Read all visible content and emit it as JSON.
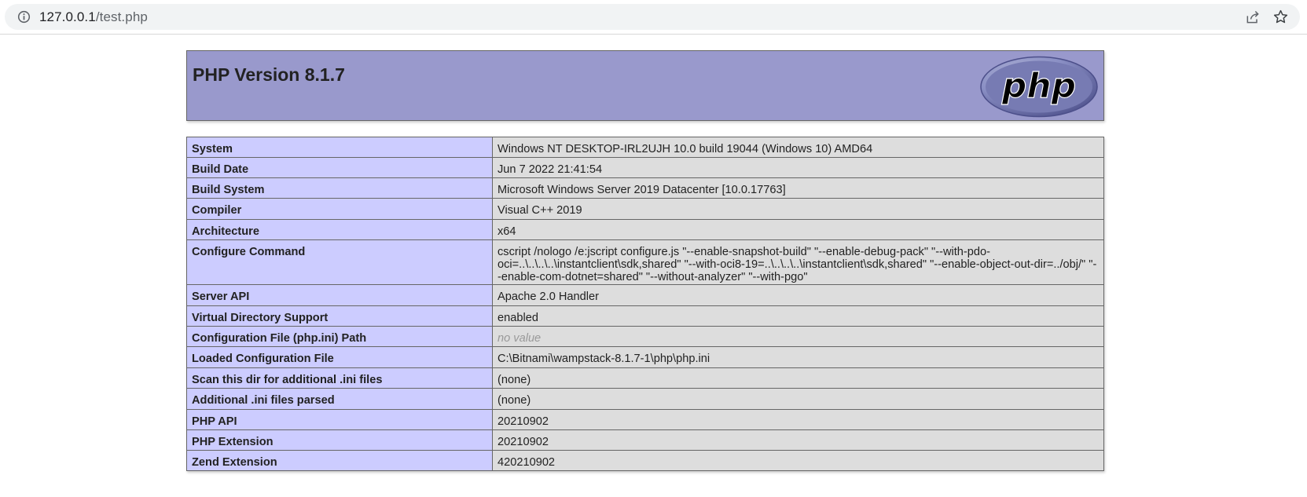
{
  "browser": {
    "url_host": "127.0.0.1",
    "url_path": "/test.php",
    "icons": {
      "site_info": "info-icon",
      "share": "share-icon",
      "bookmark": "star-icon"
    }
  },
  "header": {
    "title": "PHP Version 8.1.7",
    "logo_text": "php",
    "colors": {
      "header_bg": "#9999cc",
      "label_bg": "#ccccff",
      "value_bg": "#dddddd"
    }
  },
  "rows": [
    {
      "label": "System",
      "value": "Windows NT DESKTOP-IRL2UJH 10.0 build 19044 (Windows 10) AMD64"
    },
    {
      "label": "Build Date",
      "value": "Jun 7 2022 21:41:54"
    },
    {
      "label": "Build System",
      "value": "Microsoft Windows Server 2019 Datacenter [10.0.17763]"
    },
    {
      "label": "Compiler",
      "value": "Visual C++ 2019"
    },
    {
      "label": "Architecture",
      "value": "x64"
    },
    {
      "label": "Configure Command",
      "value": "cscript /nologo /e:jscript configure.js \"--enable-snapshot-build\" \"--enable-debug-pack\" \"--with-pdo-oci=..\\..\\..\\..\\instantclient\\sdk,shared\" \"--with-oci8-19=..\\..\\..\\..\\instantclient\\sdk,shared\" \"--enable-object-out-dir=../obj/\" \"--enable-com-dotnet=shared\" \"--without-analyzer\" \"--with-pgo\""
    },
    {
      "label": "Server API",
      "value": "Apache 2.0 Handler"
    },
    {
      "label": "Virtual Directory Support",
      "value": "enabled"
    },
    {
      "label": "Configuration File (php.ini) Path",
      "value": "no value",
      "novalue": true
    },
    {
      "label": "Loaded Configuration File",
      "value": "C:\\Bitnami\\wampstack-8.1.7-1\\php\\php.ini"
    },
    {
      "label": "Scan this dir for additional .ini files",
      "value": "(none)"
    },
    {
      "label": "Additional .ini files parsed",
      "value": "(none)"
    },
    {
      "label": "PHP API",
      "value": "20210902"
    },
    {
      "label": "PHP Extension",
      "value": "20210902"
    },
    {
      "label": "Zend Extension",
      "value": "420210902"
    }
  ]
}
